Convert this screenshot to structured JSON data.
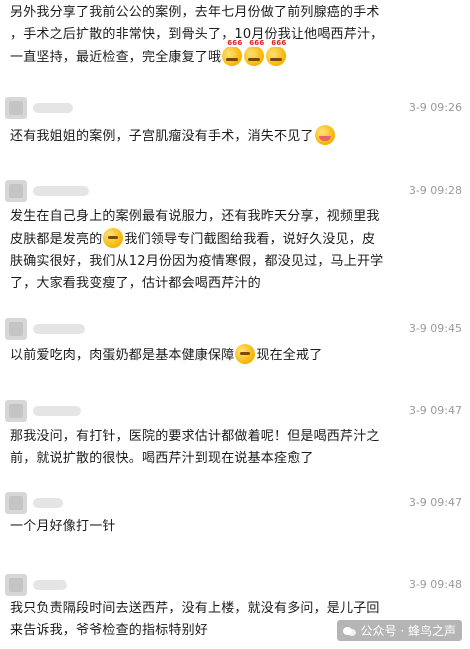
{
  "messages": [
    {
      "time": "",
      "lines": [
        {
          "text": "另外我分享了我前公公的案例，去年七月份做了前列腺癌的手术"
        },
        {
          "text": "，手术之后扩散的非常快，到骨头了，10月份我让他喝西芹汁，"
        },
        {
          "text": "一直坚持，最近检查，完全康复了哦",
          "emoji": [
            "666",
            "666",
            "666"
          ]
        }
      ]
    },
    {
      "time": "3-9 09:26",
      "lines": [
        {
          "text": "还有我姐姐的案例，子宫肌瘤没有手术，消失不见了",
          "emoji": [
            "blush"
          ]
        }
      ]
    },
    {
      "time": "3-9 09:28",
      "lines": [
        {
          "text": "发生在自己身上的案例最有说服力，还有我昨天分享，视频里我"
        },
        {
          "text": "皮肤都是发亮的",
          "emoji_mid": "thinking",
          "text2": "我们领导专门截图给我看，说好久没见，皮"
        },
        {
          "text": "肤确实很好，我们从12月份因为疫情寒假，都没见过，马上开学"
        },
        {
          "text": "了，大家看我变瘦了，估计都会喝西芹汁的"
        }
      ]
    },
    {
      "time": "3-9 09:45",
      "lines": [
        {
          "text": "以前爱吃肉，肉蛋奶都是基本健康保障",
          "emoji_mid": "thinking",
          "text2": "现在全戒了"
        }
      ]
    },
    {
      "time": "3-9 09:47",
      "lines": [
        {
          "text": "那我没问，有打针，医院的要求估计都做着呢！但是喝西芹汁之"
        },
        {
          "text": "前，就说扩散的很快。喝西芹汁到现在说基本痊愈了"
        }
      ]
    },
    {
      "time": "3-9 09:47",
      "lines": [
        {
          "text": "一个月好像打一针"
        }
      ]
    },
    {
      "time": "3-9 09:48",
      "lines": [
        {
          "text": "我只负责隔段时间去送西芹，没有上楼，就没有多问，是儿子回"
        },
        {
          "text": "来告诉我，爷爷检查的指标特别好"
        }
      ]
    }
  ],
  "watermark": {
    "label": "公众号 · 蜂鸟之声",
    "icon": "wechat-icon"
  },
  "colors": {
    "time": "#9a9a9a",
    "text": "#1b1b1b",
    "avatar": "#d7d7d7"
  }
}
